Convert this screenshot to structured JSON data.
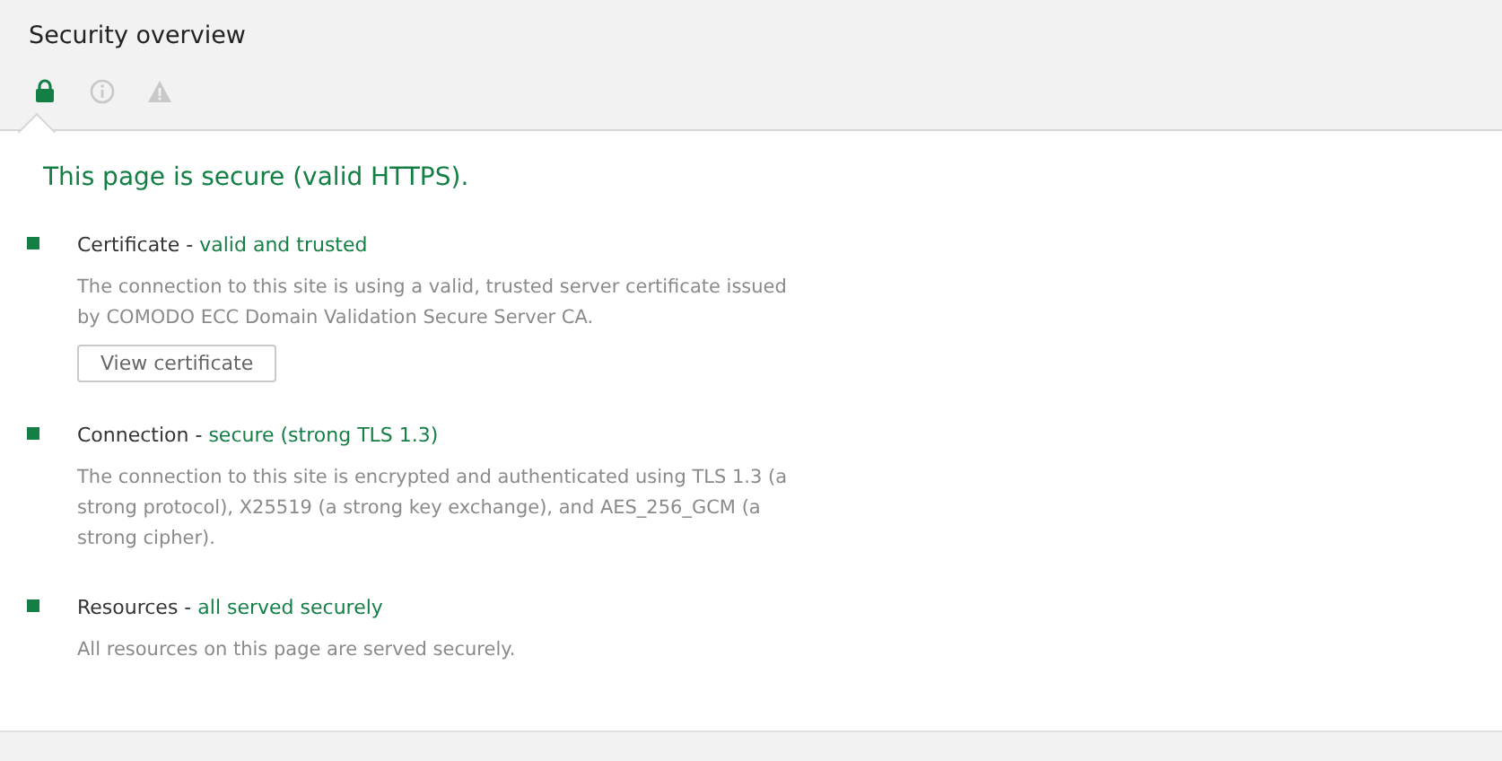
{
  "title": "Security overview",
  "tabs": [
    {
      "kind": "lock",
      "selected": true
    },
    {
      "kind": "info",
      "selected": false
    },
    {
      "kind": "warning",
      "selected": false
    }
  ],
  "summary": "This page is secure (valid HTTPS).",
  "sections": [
    {
      "label": "Certificate - ",
      "status": "valid and trusted",
      "description": "The connection to this site is using a valid, trusted server certificate issued by COMODO ECC Domain Validation Secure Server CA.",
      "button": "View certificate"
    },
    {
      "label": "Connection - ",
      "status": "secure (strong TLS 1.3)",
      "description": "The connection to this site is encrypted and authenticated using TLS 1.3 (a strong protocol), X25519 (a strong key exchange), and AES_256_GCM (a strong cipher)."
    },
    {
      "label": "Resources - ",
      "status": "all served securely",
      "description": "All resources on this page are served securely."
    }
  ]
}
